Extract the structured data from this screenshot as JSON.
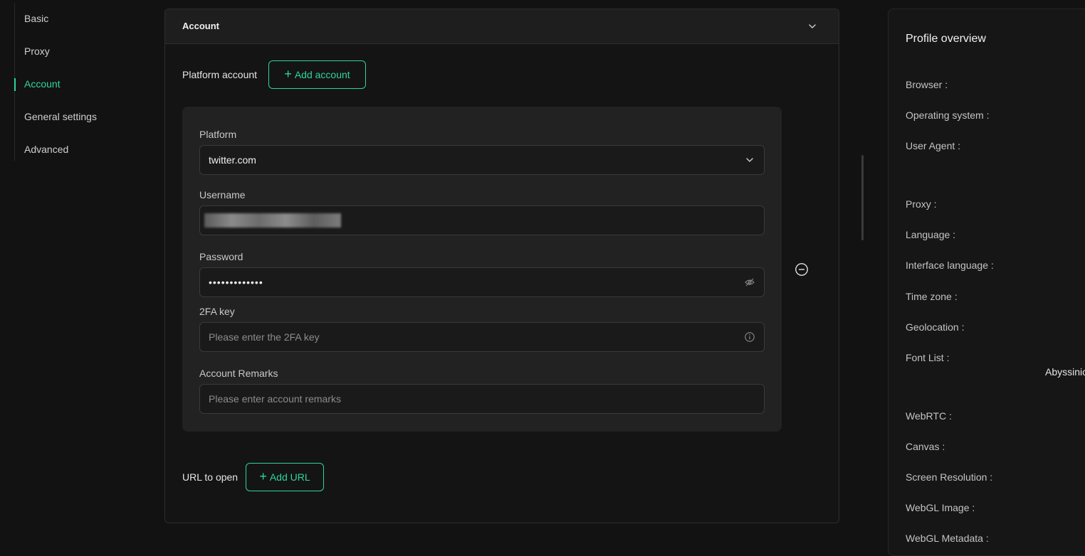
{
  "nav": {
    "items": [
      {
        "label": "Basic"
      },
      {
        "label": "Proxy"
      },
      {
        "label": "Account"
      },
      {
        "label": "General settings"
      },
      {
        "label": "Advanced"
      }
    ],
    "active": "Account"
  },
  "account_section": {
    "title": "Account",
    "platform_account_label": "Platform account",
    "add_account_label": "Add account",
    "platform": {
      "label": "Platform",
      "value": "twitter.com"
    },
    "username": {
      "label": "Username"
    },
    "password": {
      "label": "Password",
      "value": "•••••••••••••"
    },
    "twofa": {
      "label": "2FA key",
      "placeholder": "Please enter the 2FA key"
    },
    "remarks": {
      "label": "Account Remarks",
      "placeholder": "Please enter account remarks"
    },
    "url_label": "URL to open",
    "add_url_label": "Add URL"
  },
  "overview": {
    "title": "Profile overview",
    "fields": [
      {
        "label": "Browser :"
      },
      {
        "label": "Operating system :"
      },
      {
        "label": "User Agent :"
      },
      {
        "label": "Proxy :"
      },
      {
        "label": "Language :"
      },
      {
        "label": "Interface language :"
      },
      {
        "label": "Time zone :"
      },
      {
        "label": "Geolocation :"
      },
      {
        "label": "Font List :"
      },
      {
        "label": "WebRTC :"
      },
      {
        "label": "Canvas :"
      },
      {
        "label": "Screen Resolution :"
      },
      {
        "label": "WebGL Image :"
      },
      {
        "label": "WebGL Metadata :"
      }
    ],
    "font_list_value": "Abyssinic"
  },
  "colors": {
    "accent": "#2fd4a0",
    "background": "#121212",
    "card": "#222222"
  }
}
